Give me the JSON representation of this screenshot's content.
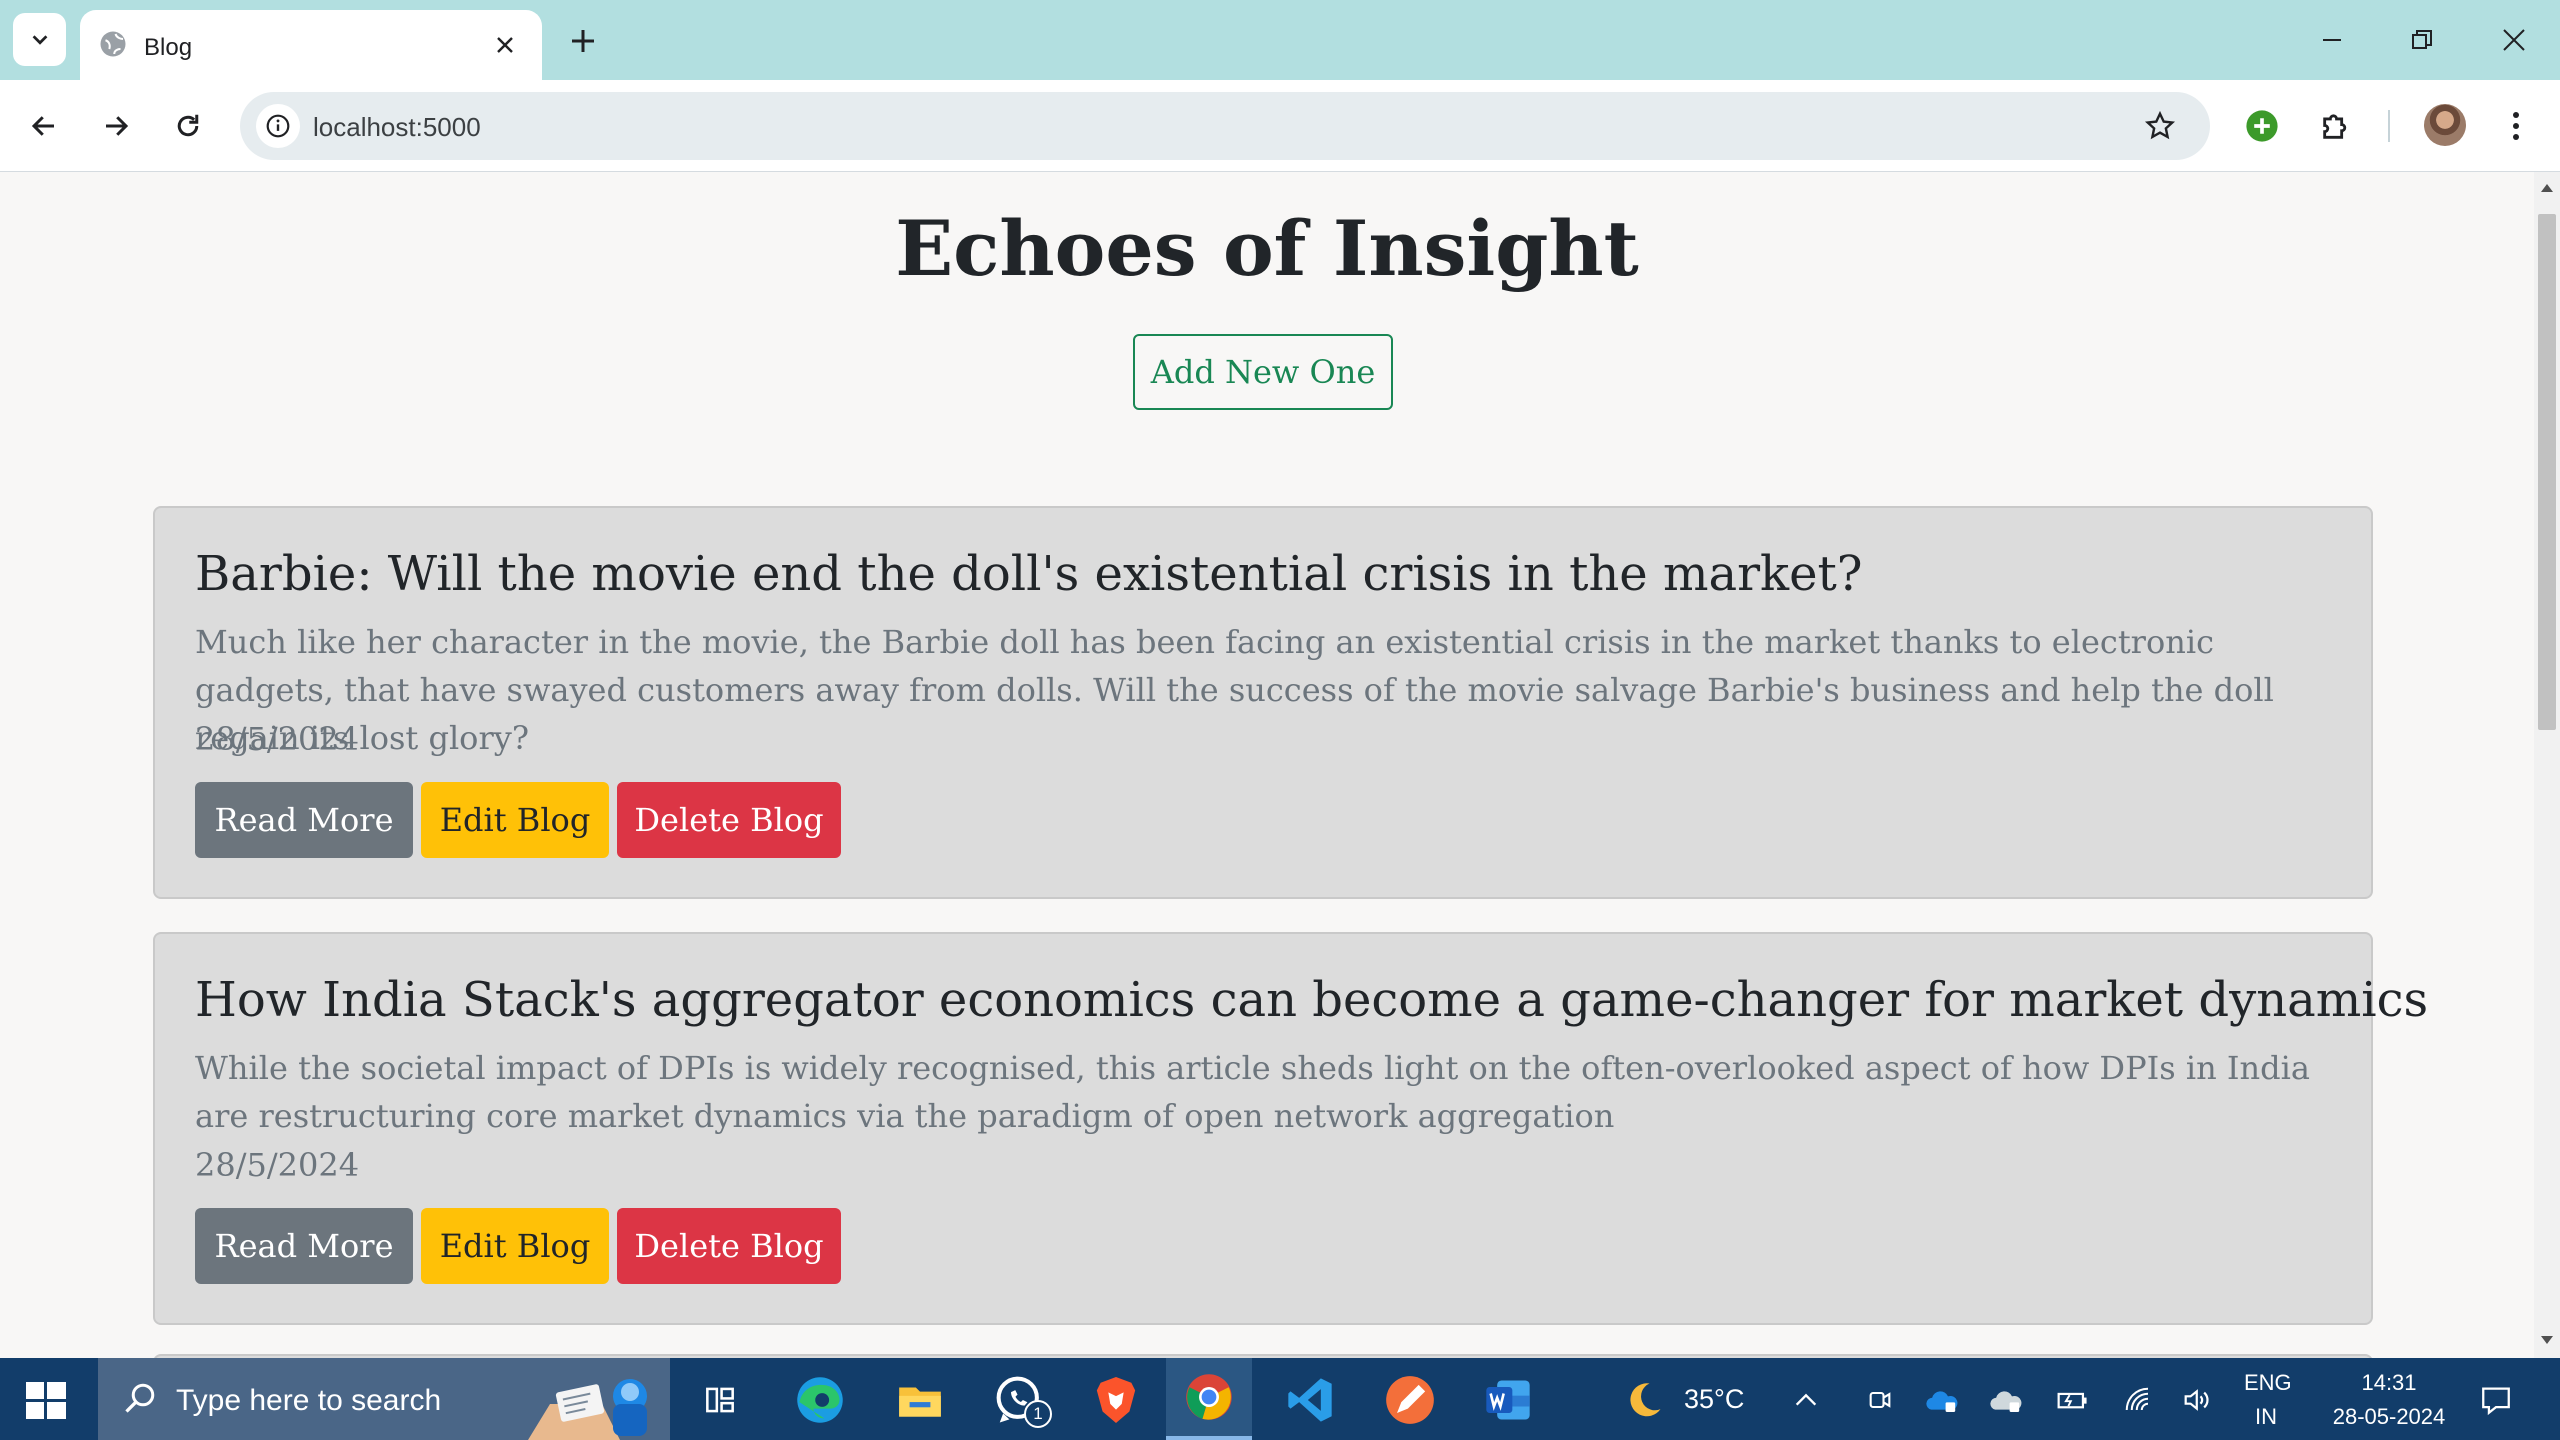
{
  "browser": {
    "tab_title": "Blog",
    "url": "localhost:5000"
  },
  "page": {
    "title": "Echoes of Insight",
    "add_button": "Add New One",
    "posts": [
      {
        "title": "Barbie: Will the movie end the doll's existential crisis in the market?",
        "description": "Much like her character in the movie, the Barbie doll has been facing an existential crisis in the market thanks to electronic gadgets, that have swayed customers away from dolls. Will the success of the movie salvage Barbie's business and help the doll regain its lost glory?",
        "date": "28/5/2024",
        "read_label": "Read More",
        "edit_label": "Edit Blog",
        "delete_label": "Delete Blog"
      },
      {
        "title": "How India Stack's aggregator economics can become a game-changer for market dynamics",
        "description": "While the societal impact of DPIs is widely recognised, this article sheds light on the often-overlooked aspect of how DPIs in India are restructuring core market dynamics via the paradigm of open network aggregation",
        "date": "28/5/2024",
        "read_label": "Read More",
        "edit_label": "Edit Blog",
        "delete_label": "Delete Blog"
      }
    ]
  },
  "taskbar": {
    "search_placeholder": "Type here to search",
    "whatsapp_badge": "1",
    "weather": "35°C",
    "lang_top": "ENG",
    "lang_bottom": "IN",
    "time": "14:31",
    "date": "28-05-2024"
  },
  "colors": {
    "success": "#198754",
    "secondary": "#6c757d",
    "warning": "#ffc107",
    "danger": "#dc3545",
    "chrome_frame": "#b2dfe0",
    "taskbar": "#123d6a"
  }
}
